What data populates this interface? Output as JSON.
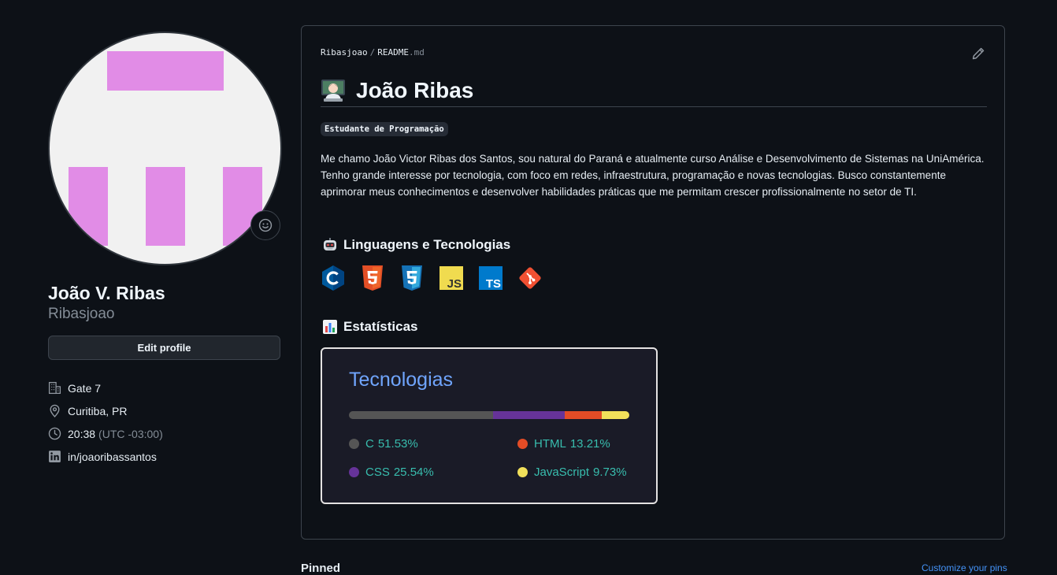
{
  "profile": {
    "name": "João V. Ribas",
    "username": "Ribasjoao",
    "edit_label": "Edit profile",
    "company": "Gate 7",
    "location": "Curitiba, PR",
    "time": "20:38",
    "timezone": "(UTC -03:00)",
    "linkedin": "in/joaoribassantos"
  },
  "readme": {
    "breadcrumb": {
      "owner": "Ribasjoao",
      "separator": "/",
      "file": "README",
      "ext": ".md"
    },
    "heading": "João Ribas",
    "badge": "Estudante de Programação",
    "paragraph": "Me chamo João Victor Ribas dos Santos, sou natural do Paraná e atualmente curso Análise e Desenvolvimento de Sistemas na UniAmérica. Tenho grande interesse por tecnologia, com foco em redes, infraestrutura, programação e novas tecnologias. Busco constantemente aprimorar meus conhecimentos e desenvolver habilidades práticas que me permitam crescer profissionalmente no setor de TI.",
    "tech_heading": "Linguagens e Tecnologias",
    "techs": [
      {
        "name": "c-icon",
        "label": "C",
        "color": "#00599c"
      },
      {
        "name": "html5-icon",
        "label": "5",
        "color": "#e34f26"
      },
      {
        "name": "css3-icon",
        "label": "3",
        "color": "#1572b6"
      },
      {
        "name": "javascript-icon",
        "label": "JS",
        "color": "#f0db4f"
      },
      {
        "name": "typescript-icon",
        "label": "TS",
        "color": "#007acc"
      },
      {
        "name": "git-icon",
        "label": "",
        "color": "#f05032"
      }
    ],
    "stats_heading": "Estatísticas"
  },
  "stats": {
    "title": "Tecnologias",
    "languages": [
      {
        "name": "C",
        "percent": "51.53%",
        "value": 51.53,
        "color": "#555555"
      },
      {
        "name": "CSS",
        "percent": "25.54%",
        "value": 25.54,
        "color": "#663399"
      },
      {
        "name": "HTML",
        "percent": "13.21%",
        "value": 13.21,
        "color": "#e34c26"
      },
      {
        "name": "JavaScript",
        "percent": "9.73%",
        "value": 9.73,
        "color": "#f1e05a"
      }
    ]
  },
  "footer": {
    "pinned": "Pinned",
    "customize": "Customize your pins"
  },
  "colors": {
    "background": "#0d1117",
    "border": "#3d444d",
    "link": "#4493f8",
    "stats_title": "#70a5fd",
    "stats_text": "#38bdae"
  }
}
